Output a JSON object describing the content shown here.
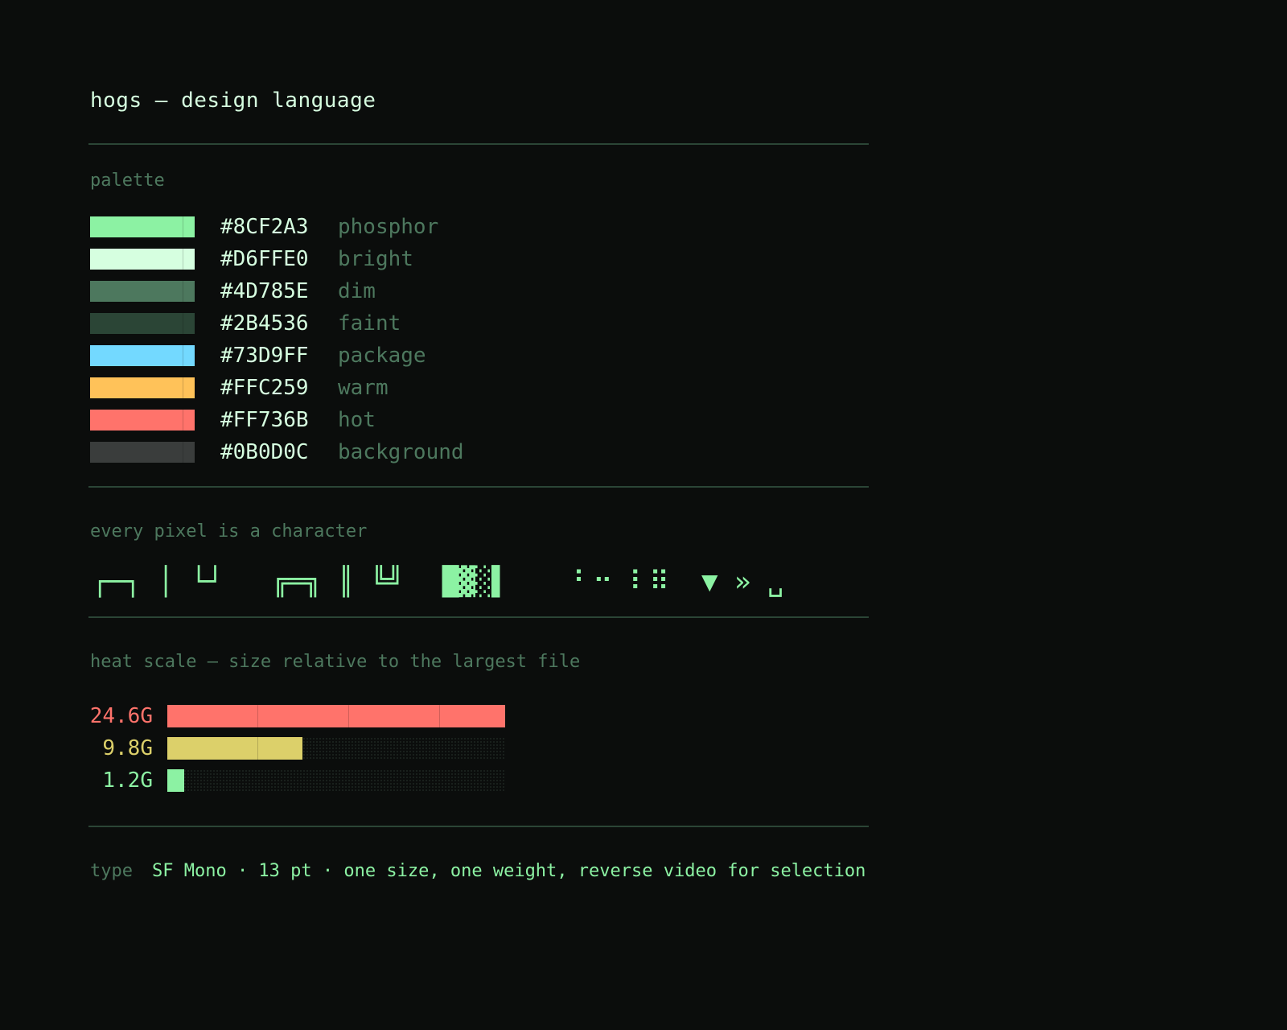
{
  "header": {
    "title": "hogs — design language"
  },
  "palette": {
    "label": "palette",
    "colors": [
      {
        "hex": "#8CF2A3",
        "name": "phosphor"
      },
      {
        "hex": "#D6FFE0",
        "name": "bright"
      },
      {
        "hex": "#4D785E",
        "name": "dim"
      },
      {
        "hex": "#2B4536",
        "name": "faint"
      },
      {
        "hex": "#73D9FF",
        "name": "package"
      },
      {
        "hex": "#FFC259",
        "name": "warm"
      },
      {
        "hex": "#FF736B",
        "name": "hot"
      },
      {
        "hex": "#0B0D0C",
        "name": "background"
      }
    ]
  },
  "glyphs": {
    "label": "every pixel is a character",
    "single_line": "┌─┐ │ └┘",
    "double_line": "╔═╗ ║ ╚╝",
    "blocks": "█▓░▌",
    "braille": "⠃⠒ ⠇⠿",
    "markers": "▼ » ␣"
  },
  "heat_scale": {
    "label": "heat scale — size relative to the largest file",
    "rows": [
      {
        "size": "24.6G",
        "fraction": 1.0,
        "color": "#FF736B"
      },
      {
        "size": "9.8G",
        "fraction": 0.4,
        "color": "#DCD06A"
      },
      {
        "size": "1.2G",
        "fraction": 0.05,
        "color": "#8CF2A3"
      }
    ]
  },
  "type": {
    "label": "type",
    "value": "SF Mono · 13 pt · one size, one weight, reverse video for selection"
  }
}
